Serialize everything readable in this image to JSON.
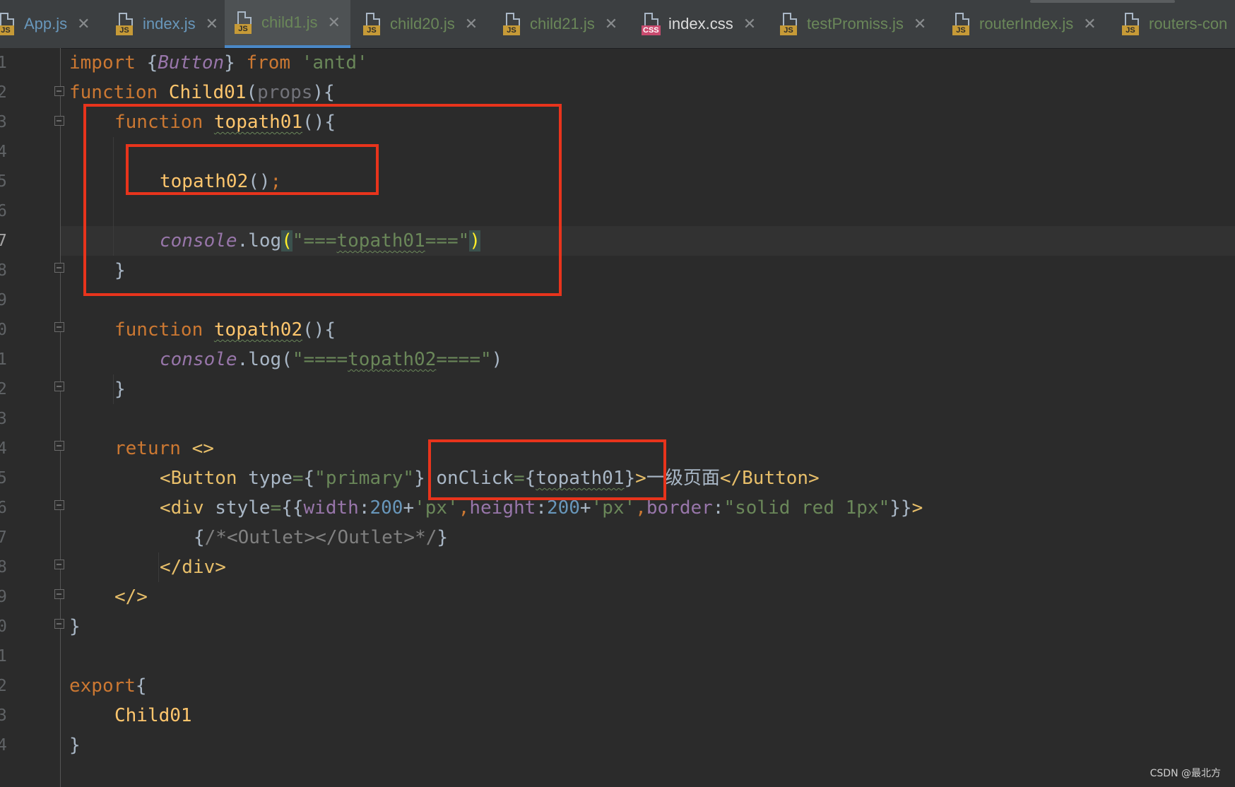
{
  "tabs": [
    {
      "label": "App.js",
      "type": "JS",
      "color": "#6897bb"
    },
    {
      "label": "index.js",
      "type": "JS",
      "color": "#6897bb"
    },
    {
      "label": "child1.js",
      "type": "JS",
      "color": "#6a8759",
      "active": true
    },
    {
      "label": "child20.js",
      "type": "JS",
      "color": "#6a8759"
    },
    {
      "label": "child21.js",
      "type": "JS",
      "color": "#6a8759"
    },
    {
      "label": "index.css",
      "type": "CSS",
      "color": "#dcdcdc"
    },
    {
      "label": "testPromiss.js",
      "type": "JS",
      "color": "#6a8759"
    },
    {
      "label": "routerIndex.js",
      "type": "JS",
      "color": "#6a8759"
    },
    {
      "label": "routers-con",
      "type": "JS",
      "color": "#6a8759"
    }
  ],
  "gutter": {
    "line_numbers": [
      "1",
      "2",
      "3",
      "4",
      "5",
      "6",
      "7",
      "8",
      "9",
      "0",
      "1",
      "2",
      "3",
      "4",
      "5",
      "6",
      "7",
      "8",
      "9",
      "0",
      "1",
      "2",
      "3",
      "4"
    ],
    "current_line": "7"
  },
  "code": {
    "l1": {
      "t1": "import ",
      "t2": "{",
      "t3": "Button",
      "t4": "} ",
      "t5": "from ",
      "t6": "'antd'"
    },
    "l2": {
      "t1": "function ",
      "t2": "Child01",
      "t3": "(",
      "t4": "props",
      "t5": "){"
    },
    "l3": {
      "t1": "function ",
      "t2": "topath01",
      "t3": "(){"
    },
    "l5": {
      "t1": "topath02",
      "t2": "()",
      "t3": ";"
    },
    "l7": {
      "t1": "console",
      "t2": ".log",
      "t3": "(",
      "t4": "\"===",
      "t5": "topath01",
      "t6": "===\"",
      "t7": ")"
    },
    "l8": {
      "t1": "}"
    },
    "l10": {
      "t1": "function ",
      "t2": "topath02",
      "t3": "(){"
    },
    "l11": {
      "t1": "console",
      "t2": ".log(",
      "t3": "\"====",
      "t4": "topath02",
      "t5": "====\"",
      "t6": ")"
    },
    "l12": {
      "t1": "}"
    },
    "l14": {
      "t1": "return ",
      "t2": "<>"
    },
    "l15": {
      "t1": "<Button ",
      "t2": "type",
      "t3": "=",
      "t4": "{",
      "t5": "\"primary\"",
      "t6": "} ",
      "t7": "onClick",
      "t8": "=",
      "t9": "{",
      "t10": "topath01",
      "t11": "}",
      "t12": ">",
      "t13": "一级页面",
      "t14": "</Button>"
    },
    "l16": {
      "t1": "<div ",
      "t2": "style",
      "t3": "=",
      "t4": "{{",
      "t5": "width",
      "t6": ":",
      "t7": "200",
      "t8": "+",
      "t9": "'px'",
      "t10": ",",
      "t11": "height",
      "t12": ":",
      "t13": "200",
      "t14": "+",
      "t15": "'px'",
      "t16": ",",
      "t17": "border",
      "t18": ":",
      "t19": "\"solid red 1px\"",
      "t20": "}}",
      "t21": ">"
    },
    "l17": {
      "t1": "{",
      "t2": "/*<Outlet></Outlet>*/",
      "t3": "}"
    },
    "l18": {
      "t1": "</div>"
    },
    "l19": {
      "t1": "</>"
    },
    "l20": {
      "t1": "}"
    },
    "l22": {
      "t1": "export",
      "t2": "{"
    },
    "l23": {
      "t1": "Child01"
    },
    "l24": {
      "t1": "}"
    }
  },
  "watermark": "CSDN @最北方",
  "colors": {
    "background": "#2b2b2b",
    "keyword": "#cc7832",
    "function": "#ffc66d",
    "string": "#6a8759",
    "number": "#6897bb",
    "annotation_red": "#e8341c"
  }
}
